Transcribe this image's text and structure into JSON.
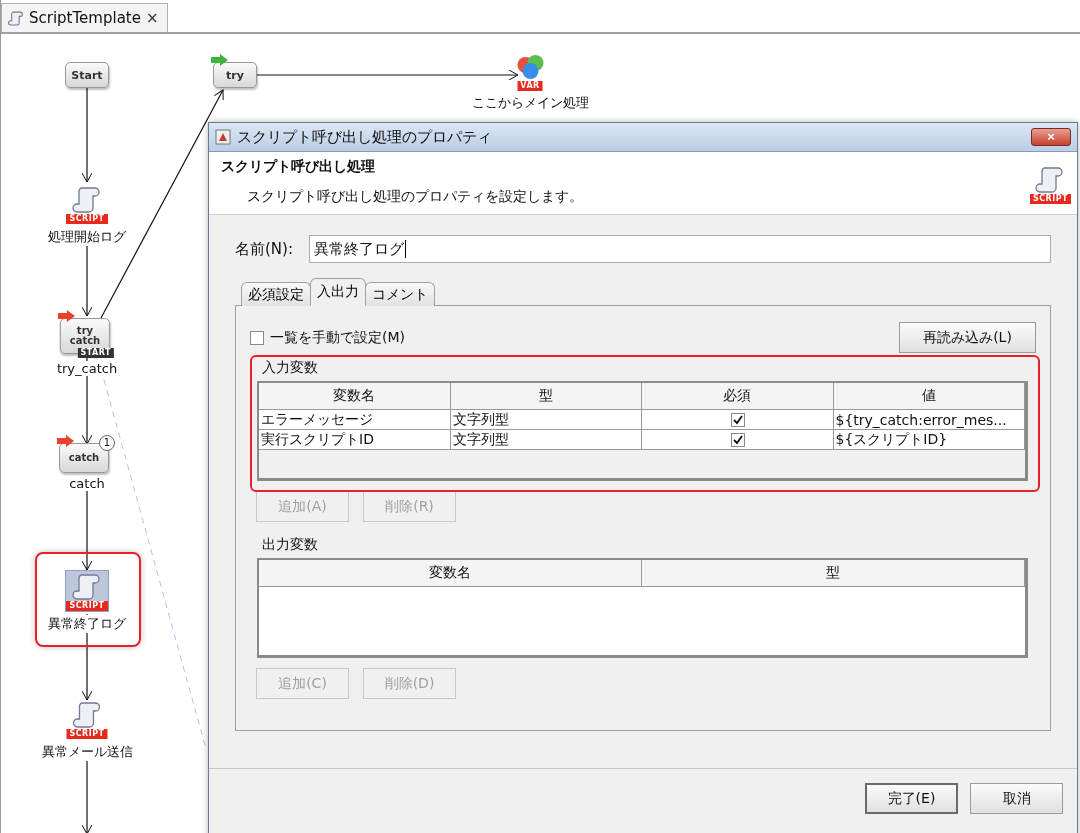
{
  "editor_tab": {
    "title": "ScriptTemplate",
    "close": "×"
  },
  "nodes": [
    {
      "kind": "start",
      "glyph": "Start"
    },
    {
      "kind": "try",
      "glyph": "try"
    },
    {
      "kind": "var",
      "badge": "VAR",
      "label": "ここからメイン処理"
    },
    {
      "kind": "script",
      "badge": "SCRIPT",
      "label": "処理開始ログ",
      "highlighted": false
    },
    {
      "kind": "try_catch",
      "glyph": "try catch",
      "badge": "START",
      "label": "try_catch"
    },
    {
      "kind": "catch",
      "glyph": "catch",
      "count": "1",
      "label": "catch"
    },
    {
      "kind": "script",
      "badge": "SCRIPT",
      "label": "異常終了ログ",
      "highlighted": true
    },
    {
      "kind": "script",
      "badge": "SCRIPT",
      "label": "異常メール送信",
      "highlighted": false
    }
  ],
  "dialog": {
    "title": "スクリプト呼び出し処理のプロパティ",
    "close": "×",
    "heading": "スクリプト呼び出し処理",
    "description": "スクリプト呼び出し処理のプロパティを設定します。",
    "header_badge": "SCRIPT",
    "name_label": "名前(N):",
    "name_value": "異常終了ログ",
    "tabs": [
      {
        "label": "必須設定",
        "selected": false
      },
      {
        "label": "入出力",
        "selected": true
      },
      {
        "label": "コメント",
        "selected": false
      }
    ],
    "manual_checkbox": {
      "label": "一覧を手動で設定(M)",
      "checked": false
    },
    "reload_button": "再読み込み(L)",
    "input_vars": {
      "title": "入力変数",
      "highlighted": true,
      "columns": [
        "変数名",
        "型",
        "必須",
        "値"
      ],
      "rows": [
        {
          "name": "エラーメッセージ",
          "type": "文字列型",
          "required": true,
          "value": "${try_catch:error_mes..."
        },
        {
          "name": "実行スクリプトID",
          "type": "文字列型",
          "required": true,
          "value": "${スクリプトID}"
        }
      ],
      "buttons": [
        {
          "label": "追加(A)",
          "disabled": true
        },
        {
          "label": "削除(R)",
          "disabled": true
        }
      ]
    },
    "output_vars": {
      "title": "出力変数",
      "columns": [
        "変数名",
        "型"
      ],
      "buttons": [
        {
          "label": "追加(C)",
          "disabled": true
        },
        {
          "label": "削除(D)",
          "disabled": true
        }
      ]
    },
    "footer_buttons": [
      {
        "label": "完了(E)",
        "default": true
      },
      {
        "label": "取消",
        "default": false
      }
    ]
  }
}
